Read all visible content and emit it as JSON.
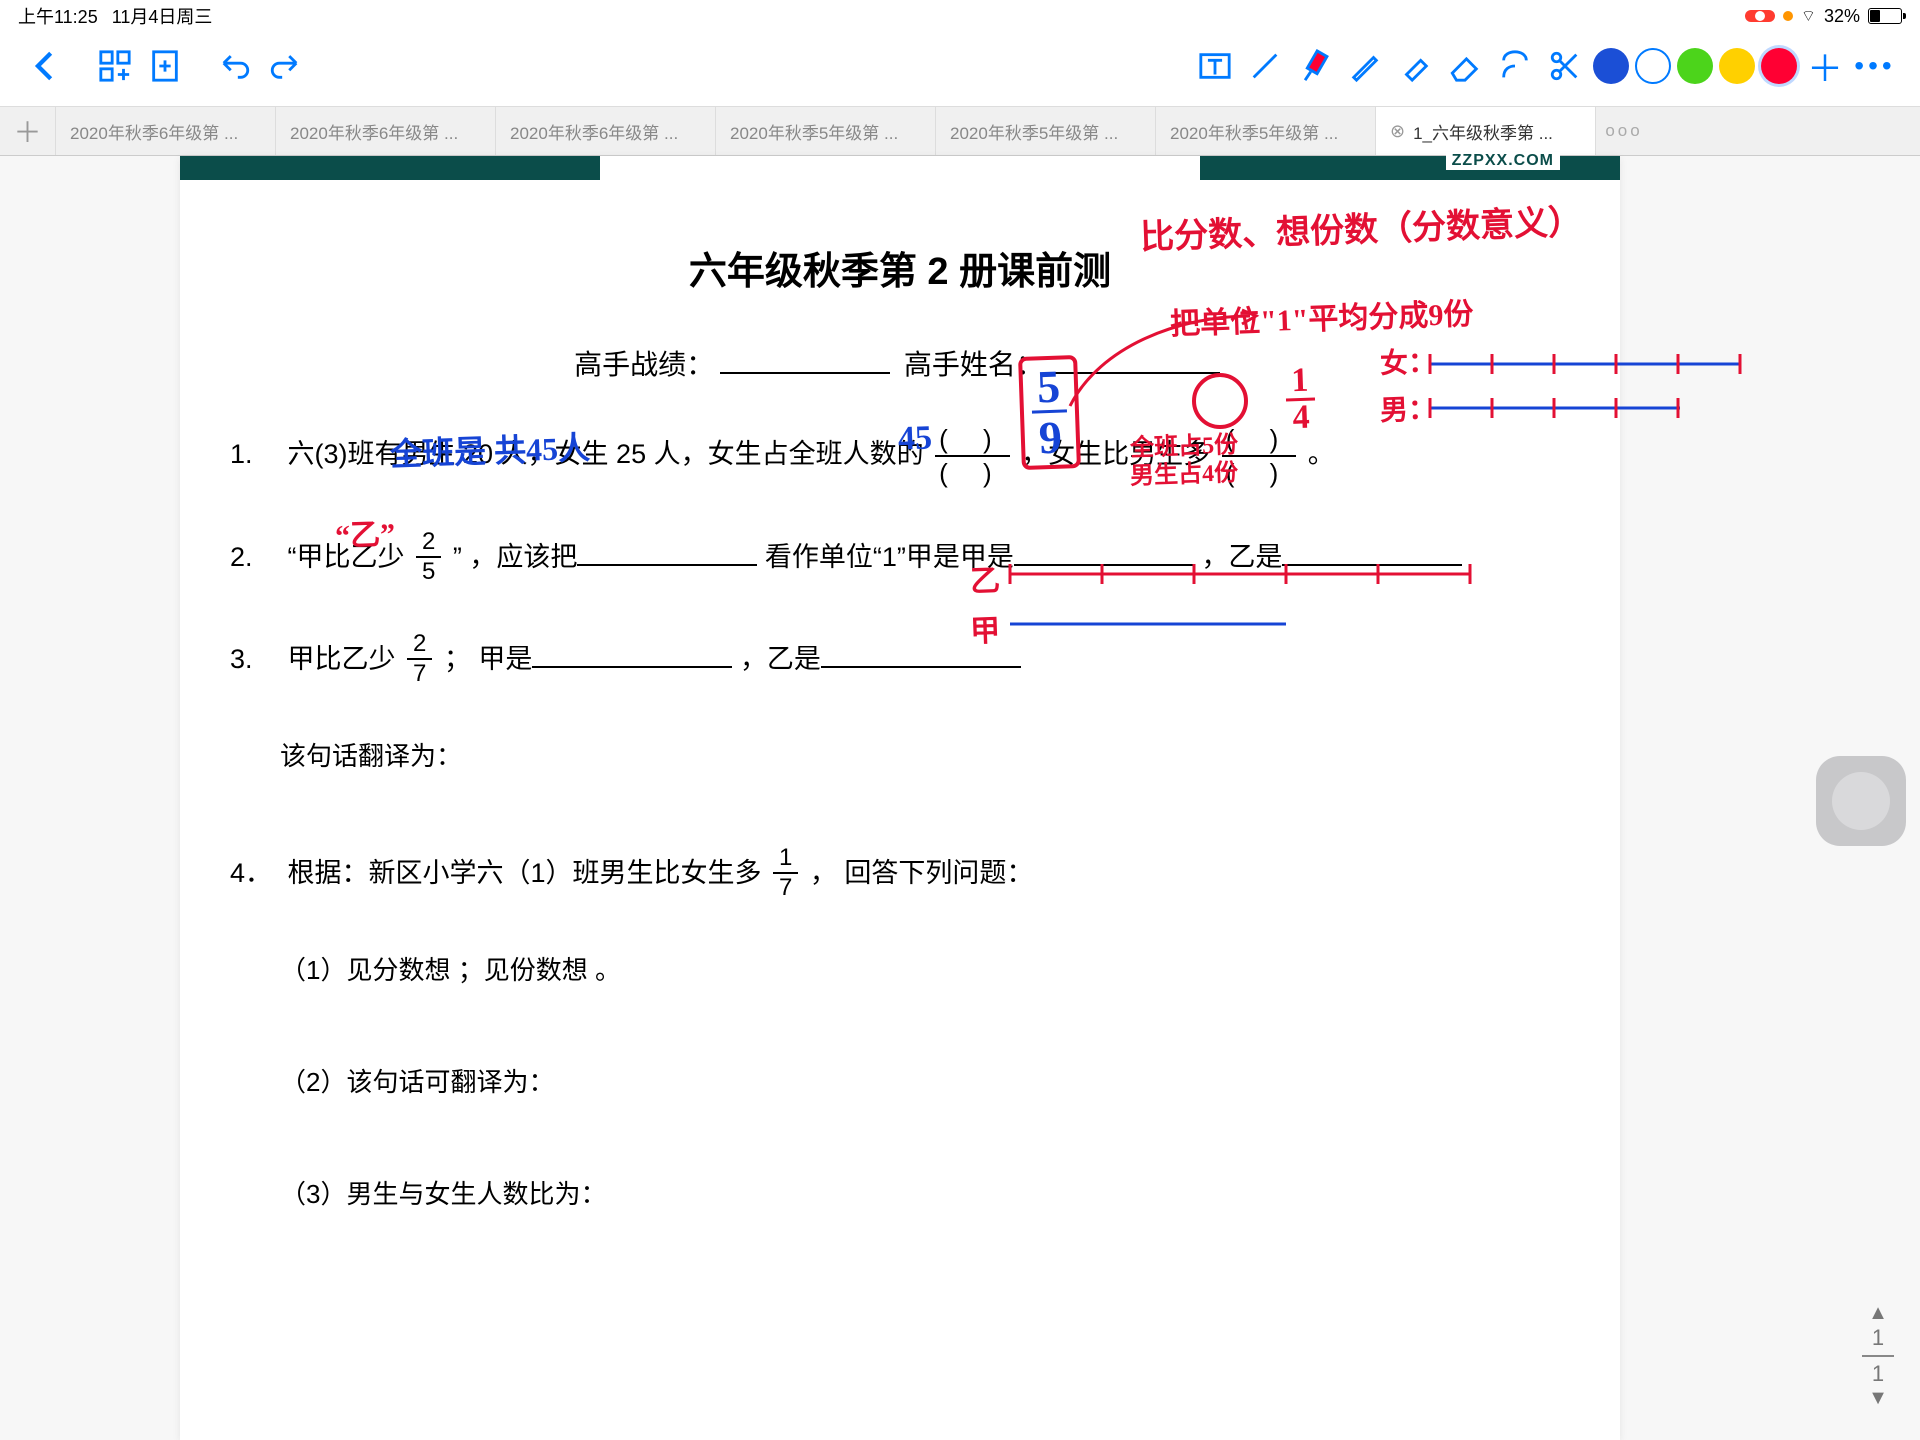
{
  "status": {
    "time": "上午11:25",
    "date": "11月4日周三",
    "battery_pct": "32%",
    "rec_icon": "⦿"
  },
  "toolbar": {
    "undo": "↶",
    "redo": "↷"
  },
  "colors": {
    "blue": "#1b4fd6",
    "white": "#ffffff",
    "green": "#4cd41b",
    "yellow": "#ffd000",
    "red": "#ff0033"
  },
  "tabs": {
    "items": [
      {
        "label": "2020年秋季6年级第 ..."
      },
      {
        "label": "2020年秋季6年级第 ..."
      },
      {
        "label": "2020年秋季6年级第 ..."
      },
      {
        "label": "2020年秋季5年级第 ..."
      },
      {
        "label": "2020年秋季5年级第 ..."
      },
      {
        "label": "2020年秋季5年级第 ..."
      },
      {
        "label": "1_六年级秋季第 ...",
        "active": true,
        "close": "⊗"
      }
    ]
  },
  "doc": {
    "watermark": "ZZPXX.COM",
    "title": "六年级秋季第 2 册课前测",
    "subtitle_a": "高手战绩：",
    "subtitle_b": "高手姓名：",
    "q1": {
      "num": "1.",
      "a": "六(3)班有男生 20 人，女生 25 人，女生占全班人数的",
      "b": "，女生比男生多",
      "c": "。"
    },
    "q2": {
      "num": "2.",
      "a": "“甲比乙少",
      "frac_n": "2",
      "frac_d": "5",
      "b": "” ，应该把",
      "c": "看作单位“1”甲是甲是",
      "d": "，乙是"
    },
    "q3": {
      "num": "3.",
      "a": "甲比乙少",
      "frac_n": "2",
      "frac_d": "7",
      "b": "； 甲是",
      "c": "，乙是",
      "translate": "该句话翻译为："
    },
    "q4": {
      "num": "4．",
      "a": "根据：新区小学六（1）班男生比女生多",
      "frac_n": "1",
      "frac_d": "7",
      "b": "， 回答下列问题：",
      "p1a": "（1）见分数想",
      "p1b": "；见份数想",
      "p1c": "。",
      "p2": "（2）该句话可翻译为：",
      "p3": "（3）男生与女生人数比为："
    }
  },
  "hand": {
    "note_top": "比分数、想份数（分数意义）",
    "note_unit": "把单位\"1\"平均分成9份",
    "note_girl": "女：",
    "note_boy": "男：",
    "blue1": "全班是 共45人",
    "blue2": "45",
    "frac_5": "5",
    "frac_9": "9",
    "red_14_1": "1",
    "red_14_4": "4",
    "red_note2": "全班占5份",
    "red_note3": "男生占4份",
    "blue_under": "“乙”",
    "z_label": "乙",
    "j_label": "甲"
  },
  "pagenav": {
    "up": "▲",
    "down": "▼",
    "cur": "1",
    "total": "1"
  }
}
